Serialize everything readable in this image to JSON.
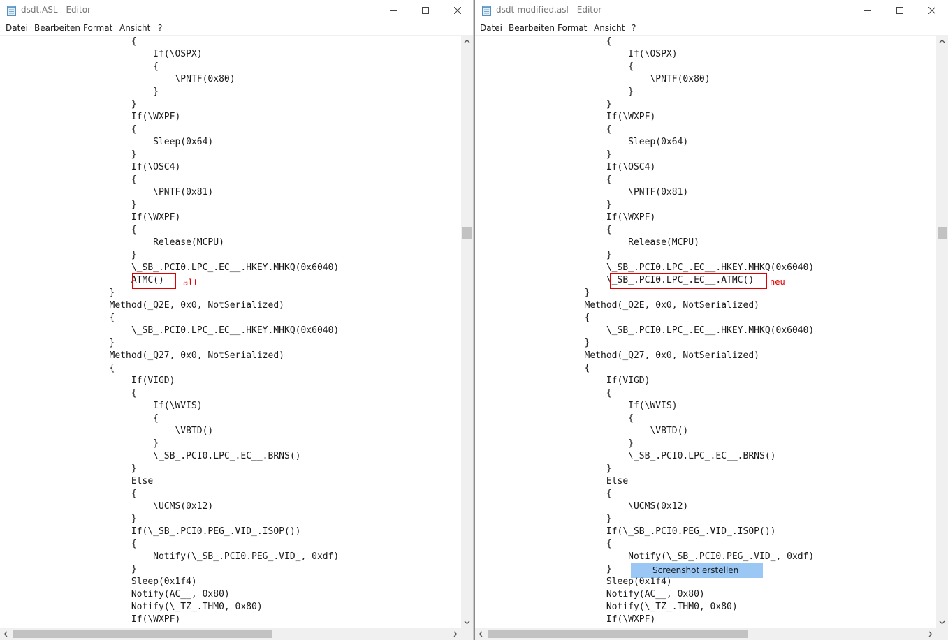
{
  "colors": {
    "accent": "#e00000",
    "tooltip": "#78b4f0"
  },
  "icons": {
    "app": "notepad-icon",
    "minimize": "minimize-icon",
    "maximize": "maximize-icon",
    "close": "close-icon"
  },
  "menu": [
    "Datei",
    "Bearbeiten",
    "Format",
    "Ansicht",
    "?"
  ],
  "left": {
    "title": "dsdt.ASL - Editor",
    "lines": [
      "                        {",
      "                            If(\\OSPX)",
      "                            {",
      "                                \\PNTF(0x80)",
      "                            }",
      "                        }",
      "                        If(\\WXPF)",
      "                        {",
      "                            Sleep(0x64)",
      "                        }",
      "                        If(\\OSC4)",
      "                        {",
      "                            \\PNTF(0x81)",
      "                        }",
      "                        If(\\WXPF)",
      "                        {",
      "                            Release(MCPU)",
      "                        }",
      "                        \\_SB_.PCI0.LPC_.EC__.HKEY.MHKQ(0x6040)",
      "                        ATMC()",
      "                    }",
      "                    Method(_Q2E, 0x0, NotSerialized)",
      "                    {",
      "                        \\_SB_.PCI0.LPC_.EC__.HKEY.MHKQ(0x6040)",
      "                    }",
      "                    Method(_Q27, 0x0, NotSerialized)",
      "                    {",
      "                        If(VIGD)",
      "                        {",
      "                            If(\\WVIS)",
      "                            {",
      "                                \\VBTD()",
      "                            }",
      "                            \\_SB_.PCI0.LPC_.EC__.BRNS()",
      "                        }",
      "                        Else",
      "                        {",
      "                            \\UCMS(0x12)",
      "                        }",
      "                        If(\\_SB_.PCI0.PEG_.VID_.ISOP())",
      "                        {",
      "                            Notify(\\_SB_.PCI0.PEG_.VID_, 0xdf)",
      "                        }",
      "                        Sleep(0x1f4)",
      "                        Notify(AC__, 0x80)",
      "                        Notify(\\_TZ_.THM0, 0x80)",
      "                        If(\\WXPF)"
    ],
    "annotation": "alt"
  },
  "right": {
    "title": "dsdt-modified.asl - Editor",
    "lines": [
      "                        {",
      "                            If(\\OSPX)",
      "                            {",
      "                                \\PNTF(0x80)",
      "                            }",
      "                        }",
      "                        If(\\WXPF)",
      "                        {",
      "                            Sleep(0x64)",
      "                        }",
      "                        If(\\OSC4)",
      "                        {",
      "                            \\PNTF(0x81)",
      "                        }",
      "                        If(\\WXPF)",
      "                        {",
      "                            Release(MCPU)",
      "                        }",
      "                        \\_SB_.PCI0.LPC_.EC__.HKEY.MHKQ(0x6040)",
      "                        \\_SB_.PCI0.LPC_.EC__.ATMC()",
      "                    }",
      "                    Method(_Q2E, 0x0, NotSerialized)",
      "                    {",
      "                        \\_SB_.PCI0.LPC_.EC__.HKEY.MHKQ(0x6040)",
      "                    }",
      "                    Method(_Q27, 0x0, NotSerialized)",
      "                    {",
      "                        If(VIGD)",
      "                        {",
      "                            If(\\WVIS)",
      "                            {",
      "                                \\VBTD()",
      "                            }",
      "                            \\_SB_.PCI0.LPC_.EC__.BRNS()",
      "                        }",
      "                        Else",
      "                        {",
      "                            \\UCMS(0x12)",
      "                        }",
      "                        If(\\_SB_.PCI0.PEG_.VID_.ISOP())",
      "                        {",
      "                            Notify(\\_SB_.PCI0.PEG_.VID_, 0xdf)",
      "                        }",
      "                        Sleep(0x1f4)",
      "                        Notify(AC__, 0x80)",
      "                        Notify(\\_TZ_.THM0, 0x80)",
      "                        If(\\WXPF)"
    ],
    "annotation": "neu",
    "tooltip": "Screenshot erstellen"
  }
}
